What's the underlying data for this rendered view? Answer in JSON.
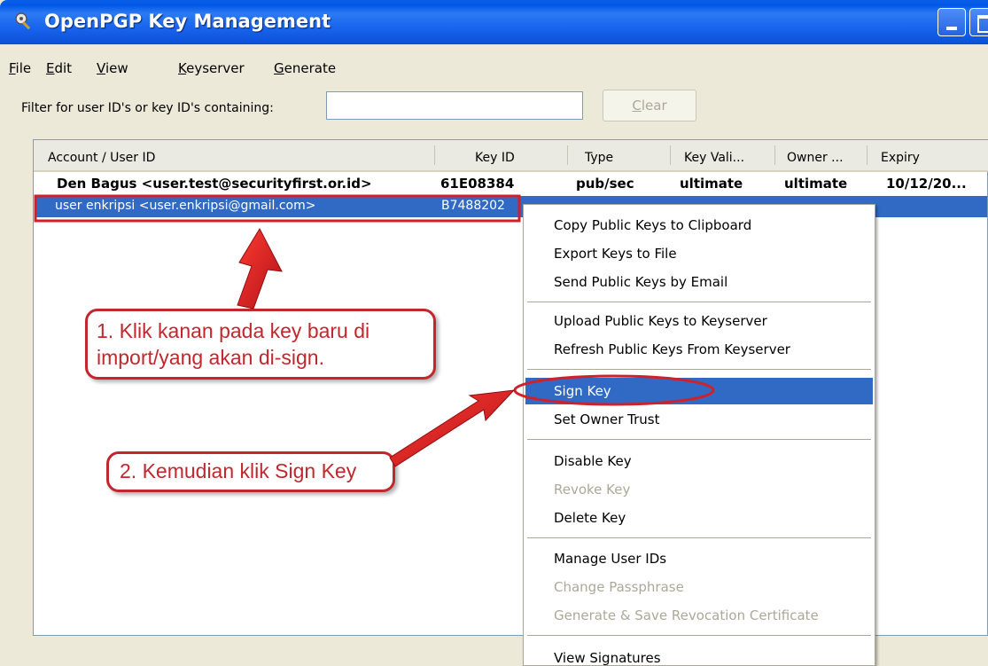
{
  "window": {
    "title": "OpenPGP Key Management"
  },
  "menubar": {
    "items": [
      {
        "hot": "F",
        "rest": "ile"
      },
      {
        "hot": "E",
        "rest": "dit"
      },
      {
        "hot": "V",
        "rest": "iew"
      },
      {
        "hot": "K",
        "rest": "eyserver"
      },
      {
        "hot": "G",
        "rest": "enerate"
      }
    ]
  },
  "filter": {
    "label": "Filter for user ID's or key ID's containing:",
    "value": "",
    "clear_hot": "C",
    "clear_rest": "lear"
  },
  "table": {
    "columns": [
      "Account / User ID",
      "Key ID",
      "Type",
      "Key Vali...",
      "Owner ...",
      "Expiry"
    ],
    "rows": [
      {
        "user": "Den Bagus <user.test@securityfirst.or.id>",
        "key_id": "61E08384",
        "type": "pub/sec",
        "validity": "ultimate",
        "owner": "ultimate",
        "expiry": "10/12/20..."
      },
      {
        "user": "user enkripsi <user.enkripsi@gmail.com>",
        "key_id": "B7488202",
        "type": "",
        "validity": "",
        "owner": "",
        "expiry": ""
      }
    ]
  },
  "context_menu": {
    "items": [
      {
        "label": "Copy Public Keys to Clipboard",
        "disabled": false
      },
      {
        "label": "Export Keys to File",
        "disabled": false
      },
      {
        "label": "Send Public Keys by Email",
        "disabled": false
      },
      {
        "label": "Upload Public Keys to Keyserver",
        "disabled": false
      },
      {
        "label": "Refresh Public Keys From Keyserver",
        "disabled": false
      },
      {
        "label": "Sign Key",
        "disabled": false,
        "highlighted": true
      },
      {
        "label": "Set Owner Trust",
        "disabled": false
      },
      {
        "label": "Disable Key",
        "disabled": false
      },
      {
        "label": "Revoke Key",
        "disabled": true
      },
      {
        "label": "Delete Key",
        "disabled": false
      },
      {
        "label": "Manage User IDs",
        "disabled": false
      },
      {
        "label": "Change Passphrase",
        "disabled": true
      },
      {
        "label": "Generate & Save Revocation Certificate",
        "disabled": true
      },
      {
        "label": "View Signatures",
        "disabled": false
      }
    ]
  },
  "annotations": {
    "callout1_line1": "1. Klik kanan pada key baru di",
    "callout1_line2": "import/yang akan di-sign.",
    "callout2": "2. Kemudian klik Sign Key",
    "color": "#C1272D"
  },
  "colors": {
    "selection": "#316AC5",
    "titlebar": "#0A5FE8",
    "annotation": "#C1272D"
  },
  "icons": {
    "app": "openpgp-key-icon"
  }
}
